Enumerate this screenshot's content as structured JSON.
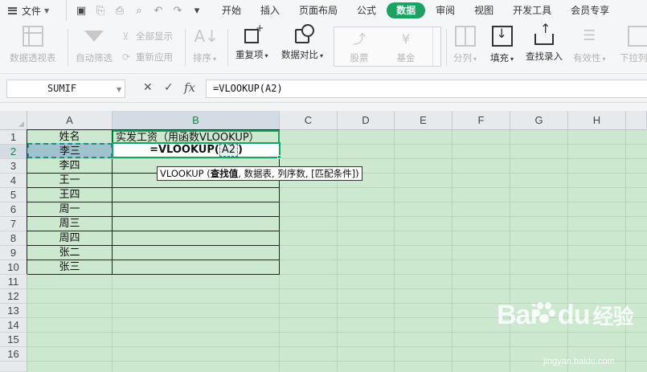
{
  "menu": {
    "file_label": "文件",
    "tabs": [
      "开始",
      "插入",
      "页面布局",
      "公式",
      "数据",
      "审阅",
      "视图",
      "开发工具",
      "会员专享"
    ],
    "active_tab": "数据"
  },
  "ribbon": {
    "pivot": "数据透视表",
    "autofilter": "自动筛选",
    "show_all": "全部显示",
    "reapply": "重新应用",
    "sort": "排序",
    "duplicates": "重复项",
    "compare": "数据对比",
    "stock": "股票",
    "fund": "基金",
    "split": "分列",
    "fill": "填充",
    "find_entry": "查找录入",
    "validity": "有效性",
    "dropdown": "下拉列表"
  },
  "formula_bar": {
    "name_box": "SUMIF",
    "fx": "fx",
    "formula": "=VLOOKUP(A2)"
  },
  "grid": {
    "columns": [
      "A",
      "B",
      "C",
      "D",
      "E",
      "F",
      "G",
      "H"
    ],
    "rows": [
      "1",
      "2",
      "3",
      "4",
      "5",
      "6",
      "7",
      "8",
      "9",
      "10",
      "11",
      "12",
      "13",
      "14",
      "15",
      "16"
    ],
    "header_a": "姓名",
    "header_b": "实发工资（用函数VLOOKUP）",
    "names": [
      "李三",
      "李四",
      "王一",
      "王四",
      "周一",
      "周三",
      "周四",
      "张二",
      "张三"
    ],
    "active_prefix": "=VLOOKUP(",
    "active_ref": "A2",
    "active_suffix": ")",
    "tooltip_func": "VLOOKUP (",
    "tooltip_arg": "查找值",
    "tooltip_rest": ", 数据表, 列序数, [匹配条件])"
  },
  "watermark": {
    "brand": "Bai",
    "brand2": "du",
    "product": "经验",
    "url": "jingyan.baidu.com"
  }
}
